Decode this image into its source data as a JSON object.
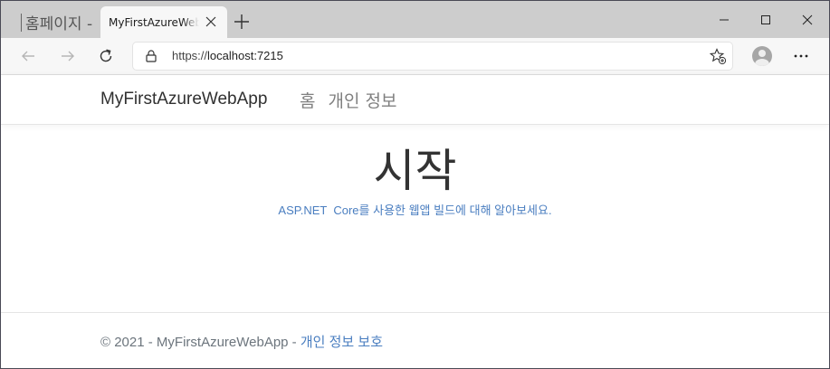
{
  "browser": {
    "partial_tab_title": "홈페이지 -",
    "active_tab_title": "MyFirstAzureWebApp",
    "url_protocol": "https://",
    "url_host": "localhost:7215",
    "accent_color": "#4a7ec0"
  },
  "site": {
    "brand": "MyFirstAzureWebApp",
    "nav": {
      "home": "홈",
      "privacy": "개인 정보"
    },
    "hero": {
      "title": "시작",
      "subtitle": "ASP.NET  Core를 사용한 웹앱 빌드에 대해 알아보세요."
    },
    "footer": {
      "copyright": "© 2021 - MyFirstAzureWebApp - ",
      "privacy_link": "개인 정보 보호"
    }
  }
}
